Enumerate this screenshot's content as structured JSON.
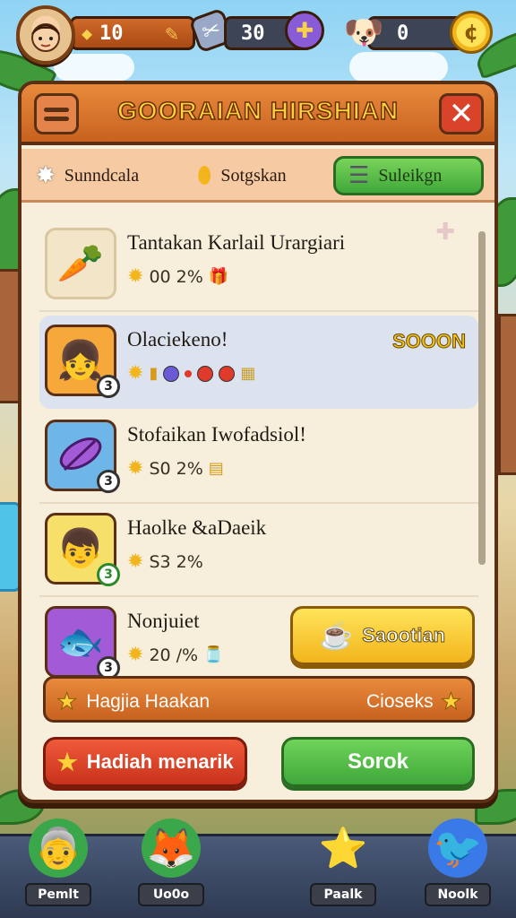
{
  "top_bar": {
    "resource_1": "10",
    "resource_2": "30",
    "resource_3": "0",
    "icons": [
      "avatar",
      "gem-icon",
      "pencil-icon",
      "tool-icon",
      "add-icon",
      "pet-icon",
      "coin-icon"
    ]
  },
  "panel": {
    "title": "GOORAIAN HIRSHIAN",
    "tabs": [
      {
        "label": "Sunndcala",
        "icon": "star-icon"
      },
      {
        "label": "Sotgskan",
        "icon": "coin-icon"
      },
      {
        "label": "Suleikgn",
        "icon": "cake-icon",
        "active": true
      }
    ],
    "rows": [
      {
        "title": "Tantakan Karlail Urargiari",
        "stat": "00 2%",
        "icon": "carrot-icon",
        "badge": ""
      },
      {
        "title": "Olaciekeno!",
        "stat": "",
        "icon": "girl-avatar",
        "badge": "3",
        "tag": "SOOON",
        "selected": true
      },
      {
        "title": "Stofaikan Iwofadsiol!",
        "stat": "S0 2%",
        "icon": "feather-icon",
        "badge": "3"
      },
      {
        "title": "Haolke &aDaeik",
        "stat": "S3 2%",
        "icon": "boy-avatar",
        "badge": "3"
      },
      {
        "title": "Nonjuiet",
        "stat": "20 /%",
        "icon": "fish-icon",
        "badge": "3",
        "action_label": "Saootian"
      }
    ],
    "reward_bar": {
      "left_label": "Hagjia Haakan",
      "right_label": "Cioseks"
    },
    "buttons": {
      "red": "Hadiah menarik",
      "green": "Sorok"
    }
  },
  "bottom_nav": [
    {
      "label": "Pemlt",
      "icon": "grandma-character"
    },
    {
      "label": "Uo0o",
      "icon": "fox-character"
    },
    {
      "label": "Paalk",
      "icon": "star-character"
    },
    {
      "label": "Noolk",
      "icon": "bird-character"
    }
  ],
  "colors": {
    "panel_bg": "#f7eedb",
    "header_orange": "#c8621f",
    "title_gold": "#ffd23a",
    "close_red": "#d8432a",
    "tab_green": "#3fa83a",
    "selected_row": "#dce3ee",
    "action_yellow": "#f2b51c",
    "nav_bg": "#2e3a52"
  }
}
